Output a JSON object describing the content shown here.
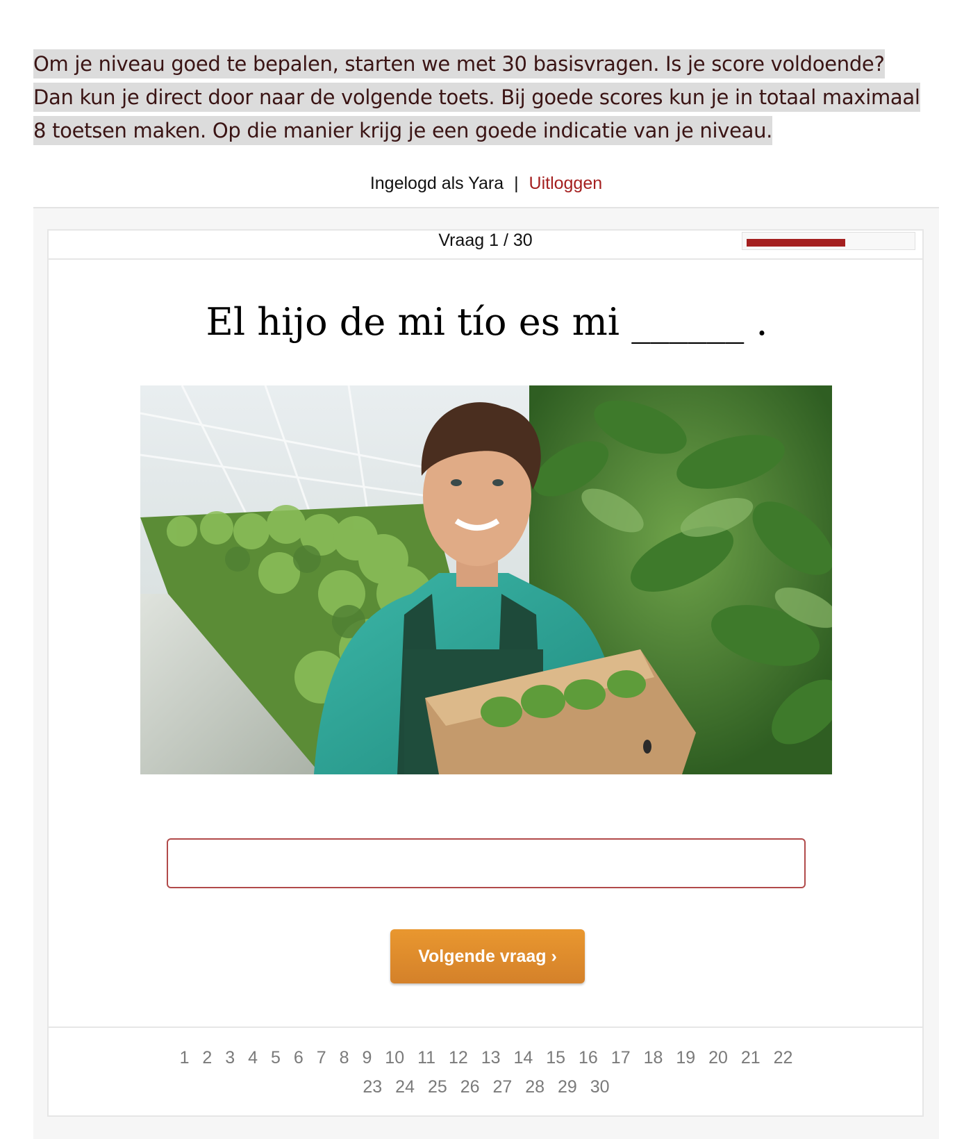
{
  "intro": {
    "text": "Om je niveau goed te bepalen, starten we met 30 basisvragen. Is je score voldoende? Dan kun je direct door naar de volgende toets. Bij goede scores kun je in totaal maximaal 8 toetsen maken. Op die manier krijg je een goede indicatie van je niveau."
  },
  "login": {
    "label": "Ingelogd als Yara",
    "separator": "|",
    "logout": "Uitloggen"
  },
  "quiz": {
    "counter": "Vraag 1 / 30",
    "progress_fraction": 0.6,
    "question": "El hijo de mi tío es mi ______ .",
    "answer_value": "",
    "next_label": "Volgende vraag ›",
    "pages": [
      "1",
      "2",
      "3",
      "4",
      "5",
      "6",
      "7",
      "8",
      "9",
      "10",
      "11",
      "12",
      "13",
      "14",
      "15",
      "16",
      "17",
      "18",
      "19",
      "20",
      "21",
      "22",
      "23",
      "24",
      "25",
      "26",
      "27",
      "28",
      "29",
      "30"
    ]
  },
  "colors": {
    "accent": "#a41f1f",
    "button": "#e08d2d"
  }
}
